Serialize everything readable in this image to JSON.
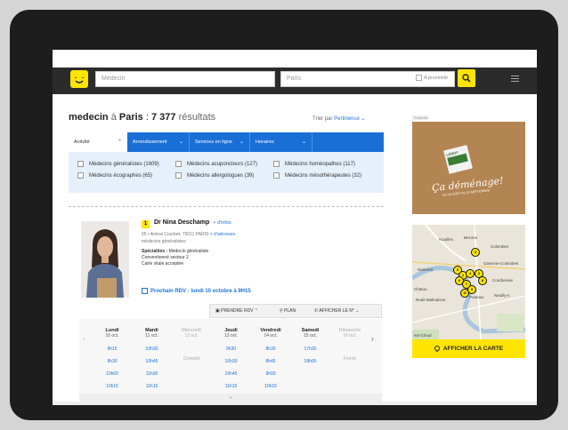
{
  "header": {
    "search_placeholder": "Médecin",
    "where_placeholder": "Paris",
    "proximity_label": "A proximité"
  },
  "results": {
    "query": "medecin",
    "connector": "à",
    "city": "Paris",
    "count": "7 377",
    "suffix": "résultats",
    "sort_label": "Trier par",
    "sort_value": "Pertinence"
  },
  "filter_tabs": [
    "Activité",
    "Arrondissement",
    "Services en ligne",
    "Horaires"
  ],
  "filters": [
    "Médecins généralistes (1609)",
    "Médecins acuponcteurs (127)",
    "Médecins homéopathes (117)",
    "Médecins écographes (65)",
    "Médecins allergologues (39)",
    "Médecins mésothérapeutes (32)"
  ],
  "listing": {
    "number": "1",
    "name": "Dr Nina Deschamp",
    "more_info": "+ d'infos",
    "address": "65 r Amiral Courbet, 75011 PARIS",
    "more_addresses": "+ d'adresses",
    "category": "médecins généralistes",
    "specialty_label": "Spécialités :",
    "specialty_value": "Médecin généraliste",
    "sector": "Conventionné secteur 2",
    "card": "Carte vitale acceptée",
    "next_appt": "Prochain RDV : lundi 10 octobre à 9H15"
  },
  "actions": {
    "book": "PRENDRE RDV",
    "plan": "PLAN",
    "show_number": "AFFICHER LE N°"
  },
  "calendar": [
    {
      "day": "Lundi",
      "date": "10 oct.",
      "slots": [
        "9h15",
        "9h30",
        "10h00",
        "10h15"
      ],
      "status": ""
    },
    {
      "day": "Mardi",
      "date": "11 oct.",
      "slots": [
        "10h30",
        "10h45",
        "11h00",
        "11h15"
      ],
      "status": ""
    },
    {
      "day": "Mercredi",
      "date": "12 oct.",
      "slots": [],
      "status": "Complet"
    },
    {
      "day": "Jeudi",
      "date": "13 oct.",
      "slots": [
        "9h30",
        "10h30",
        "10h45",
        "11h15"
      ],
      "status": ""
    },
    {
      "day": "Vendredi",
      "date": "14 oct.",
      "slots": [
        "8h30",
        "8h45",
        "9h00",
        "10h15"
      ],
      "status": ""
    },
    {
      "day": "Samedi",
      "date": "15 oct.",
      "slots": [
        "17h30",
        "18h00"
      ],
      "status": ""
    },
    {
      "day": "Dimanche",
      "date": "16 oct.",
      "slots": [],
      "status": "Fermé"
    }
  ],
  "ad": {
    "tag": "Publicité",
    "brand": "LEROY MERLIN",
    "headline": "Ça déménage!",
    "sub": "DU 14 AOÛT AU 20 SEPTEMBRE"
  },
  "map": {
    "button": "AFFICHER LA CARTE",
    "places": [
      "Nanterre",
      "Houilles",
      "Bezons",
      "Colombes",
      "Garenne-Colombes",
      "Courbevoie",
      "Puteaux",
      "Neuilly-s",
      "Chatou",
      "Rueil-Malmaison",
      "ent-Cloud"
    ],
    "pins": [
      "1",
      "2",
      "3",
      "4",
      "5",
      "6",
      "7",
      "8",
      "9",
      "10"
    ]
  }
}
